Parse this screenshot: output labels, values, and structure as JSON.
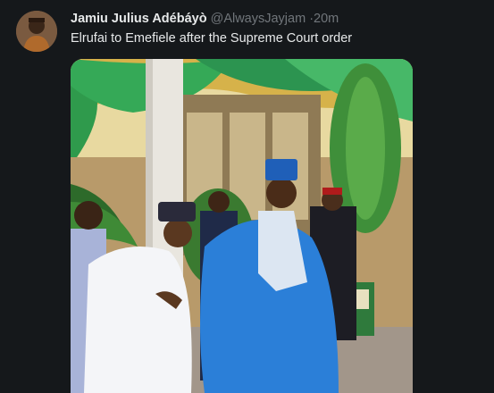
{
  "tweet": {
    "display_name": "Jamiu Julius Adébáyò",
    "handle": "@AlwaysJayjam",
    "separator": "·",
    "timestamp": "20m",
    "text": "Elrufai to Emefiele after the Supreme Court order"
  },
  "media": {
    "type": "photo",
    "icon": "photo-icon"
  },
  "colors": {
    "background": "#15181b",
    "primary_text": "#e7e9ea",
    "secondary_text": "#71767b"
  }
}
